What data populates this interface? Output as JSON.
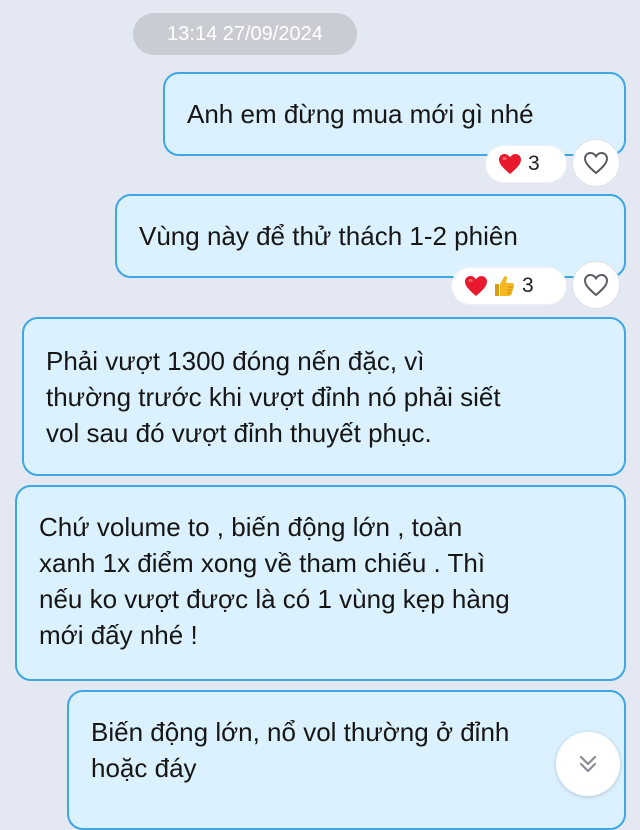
{
  "chat": {
    "timestamp": "13:14 27/09/2024",
    "messages": [
      {
        "text": "Anh em đừng mua mới gì nhé",
        "reactions": {
          "icons": [
            "heart-icon"
          ],
          "count": "3"
        }
      },
      {
        "text": "Vùng này để thử thách 1-2 phiên",
        "reactions": {
          "icons": [
            "heart-icon",
            "thumbs-up-icon"
          ],
          "count": "3"
        }
      },
      {
        "text": "Phải vượt 1300 đóng nến đặc, vì\nthường trước khi vượt đỉnh nó phải siết\nvol sau đó vượt đỉnh thuyết phục."
      },
      {
        "text": "Chứ volume to , biến động lớn , toàn\nxanh 1x điểm xong về tham chiếu . Thì\nnếu ko vượt được là có 1 vùng kẹp hàng\nmới đấy nhé !"
      },
      {
        "text": "Biến động lớn, nổ vol thường ở đỉnh\nhoặc đáy"
      }
    ]
  },
  "colors": {
    "background": "#e4e8f2",
    "bubble_fill": "#dbf1fe",
    "bubble_border": "#3ea7e3",
    "heart": "#e8192c",
    "thumbs_up": "#f5b722"
  },
  "controls": {
    "scroll_down_icon": "double-chevron-down-icon",
    "react_icon": "heart-outline-icon"
  }
}
